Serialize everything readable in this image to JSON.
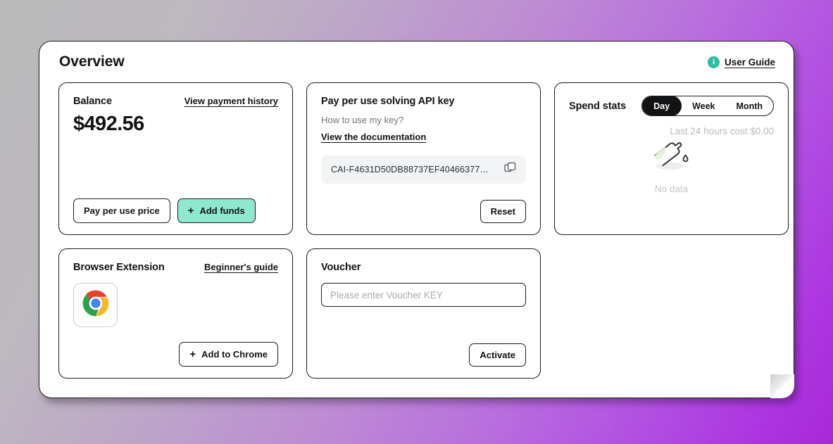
{
  "header": {
    "title": "Overview",
    "user_guide_label": "User Guide",
    "info_icon": "info-icon",
    "info_icon_color": "#2bbda0"
  },
  "balance_card": {
    "title": "Balance",
    "history_link": "View payment history",
    "amount": "$492.56",
    "price_button": "Pay per use price",
    "add_funds_button": "Add funds",
    "add_funds_plus": "+",
    "add_funds_color": "#8ee8ce"
  },
  "api_key_card": {
    "title": "Pay per use solving API key",
    "question": "How to use my key?",
    "doc_link": "View the documentation",
    "key_value": "CAI-F4631D50DB88737EF40466377…",
    "copy_icon": "copy-icon",
    "reset_button": "Reset"
  },
  "spend_stats_card": {
    "title": "Spend stats",
    "ranges": [
      {
        "label": "Day",
        "active": true
      },
      {
        "label": "Week",
        "active": false
      },
      {
        "label": "Month",
        "active": false
      }
    ],
    "cost_text": "Last 24 hours cost $0.00",
    "empty_icon": "empty-bottle-icon",
    "empty_label": "No data"
  },
  "browser_extension_card": {
    "title": "Browser Extension",
    "guide_link": "Beginner's guide",
    "browser_icon": "chrome-logo-icon",
    "add_button": "Add to Chrome",
    "add_button_plus": "+"
  },
  "voucher_card": {
    "title": "Voucher",
    "input_value": "",
    "input_placeholder": "Please enter Voucher KEY",
    "activate_button": "Activate"
  }
}
